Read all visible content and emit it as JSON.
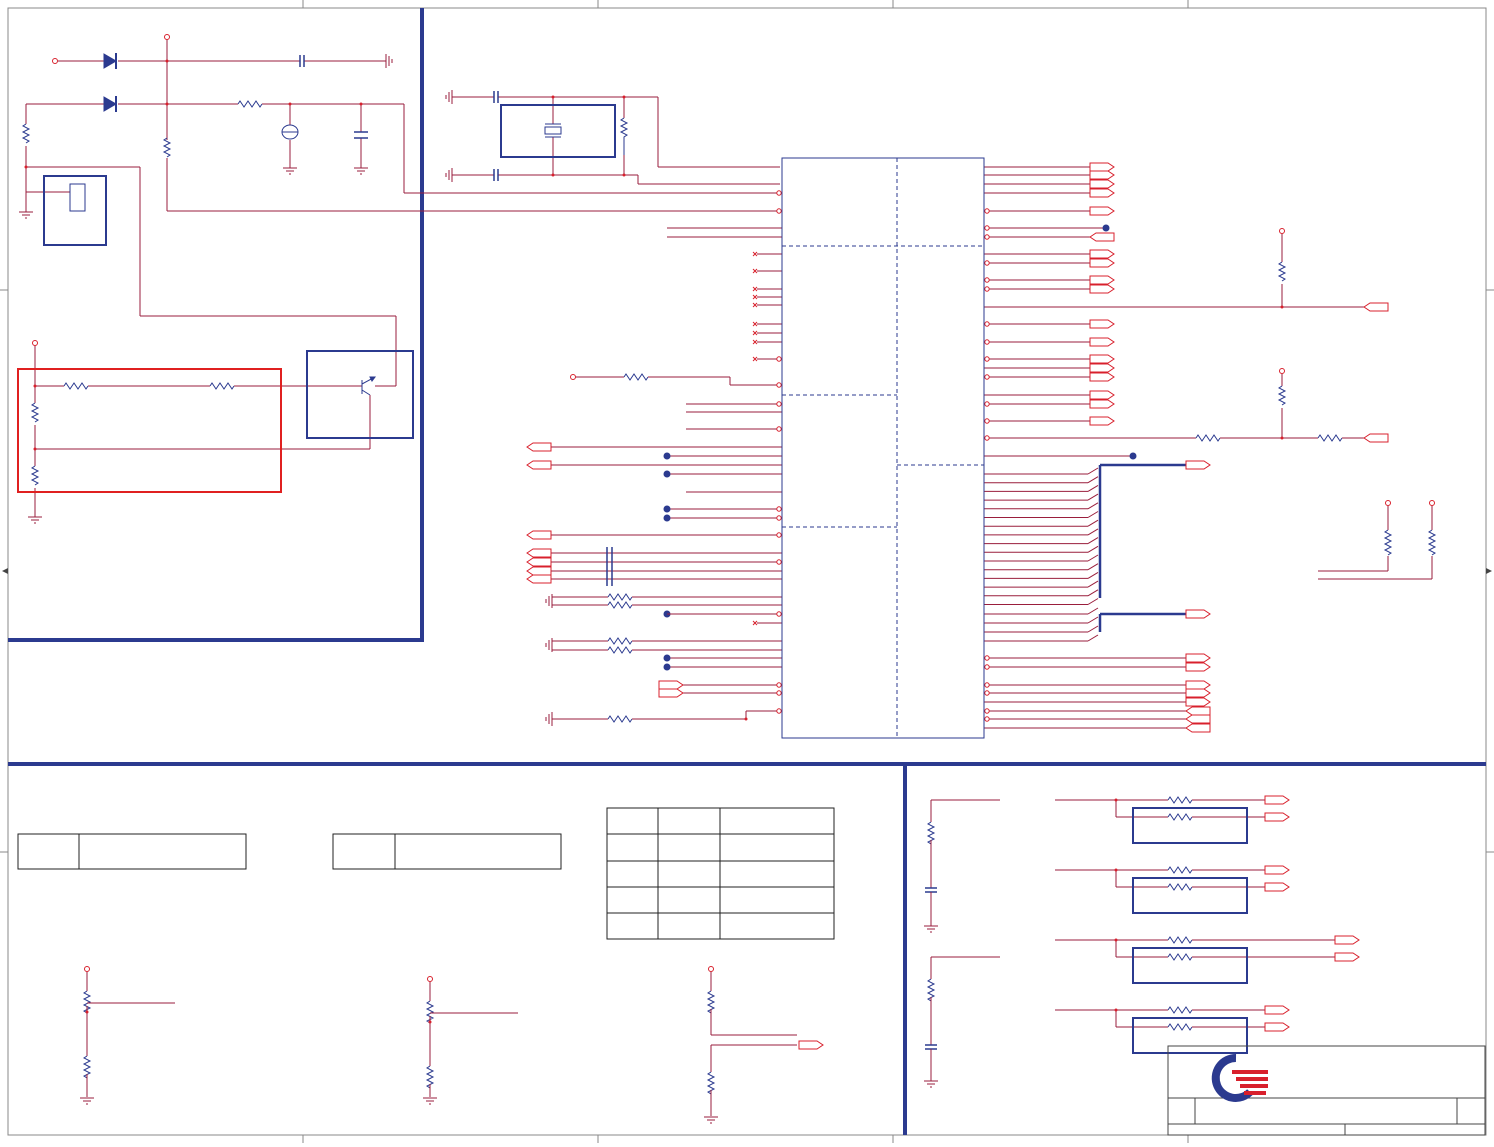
{
  "palette": {
    "wire": "#9a1e3c",
    "port": "#d8202c",
    "component": "#2b3a8f",
    "border": "#2b3a8f",
    "highlight": "#e02020",
    "frame": "#888888"
  },
  "icons": {
    "logo": "quanta-q-logo",
    "diode": "zener-diode-icon",
    "ground": "ground-icon",
    "resistor": "resistor-icon",
    "capacitor": "capacitor-icon",
    "transistor": "transistor-icon",
    "crystal": "crystal-icon",
    "port": "off-page-connector-icon"
  },
  "ic": {
    "sections": 6
  },
  "tables": {
    "strap_table_rows": 5,
    "strap_table_cols": 3
  },
  "title_block": {
    "company": "",
    "title": "",
    "document_number": "",
    "revision": ""
  }
}
